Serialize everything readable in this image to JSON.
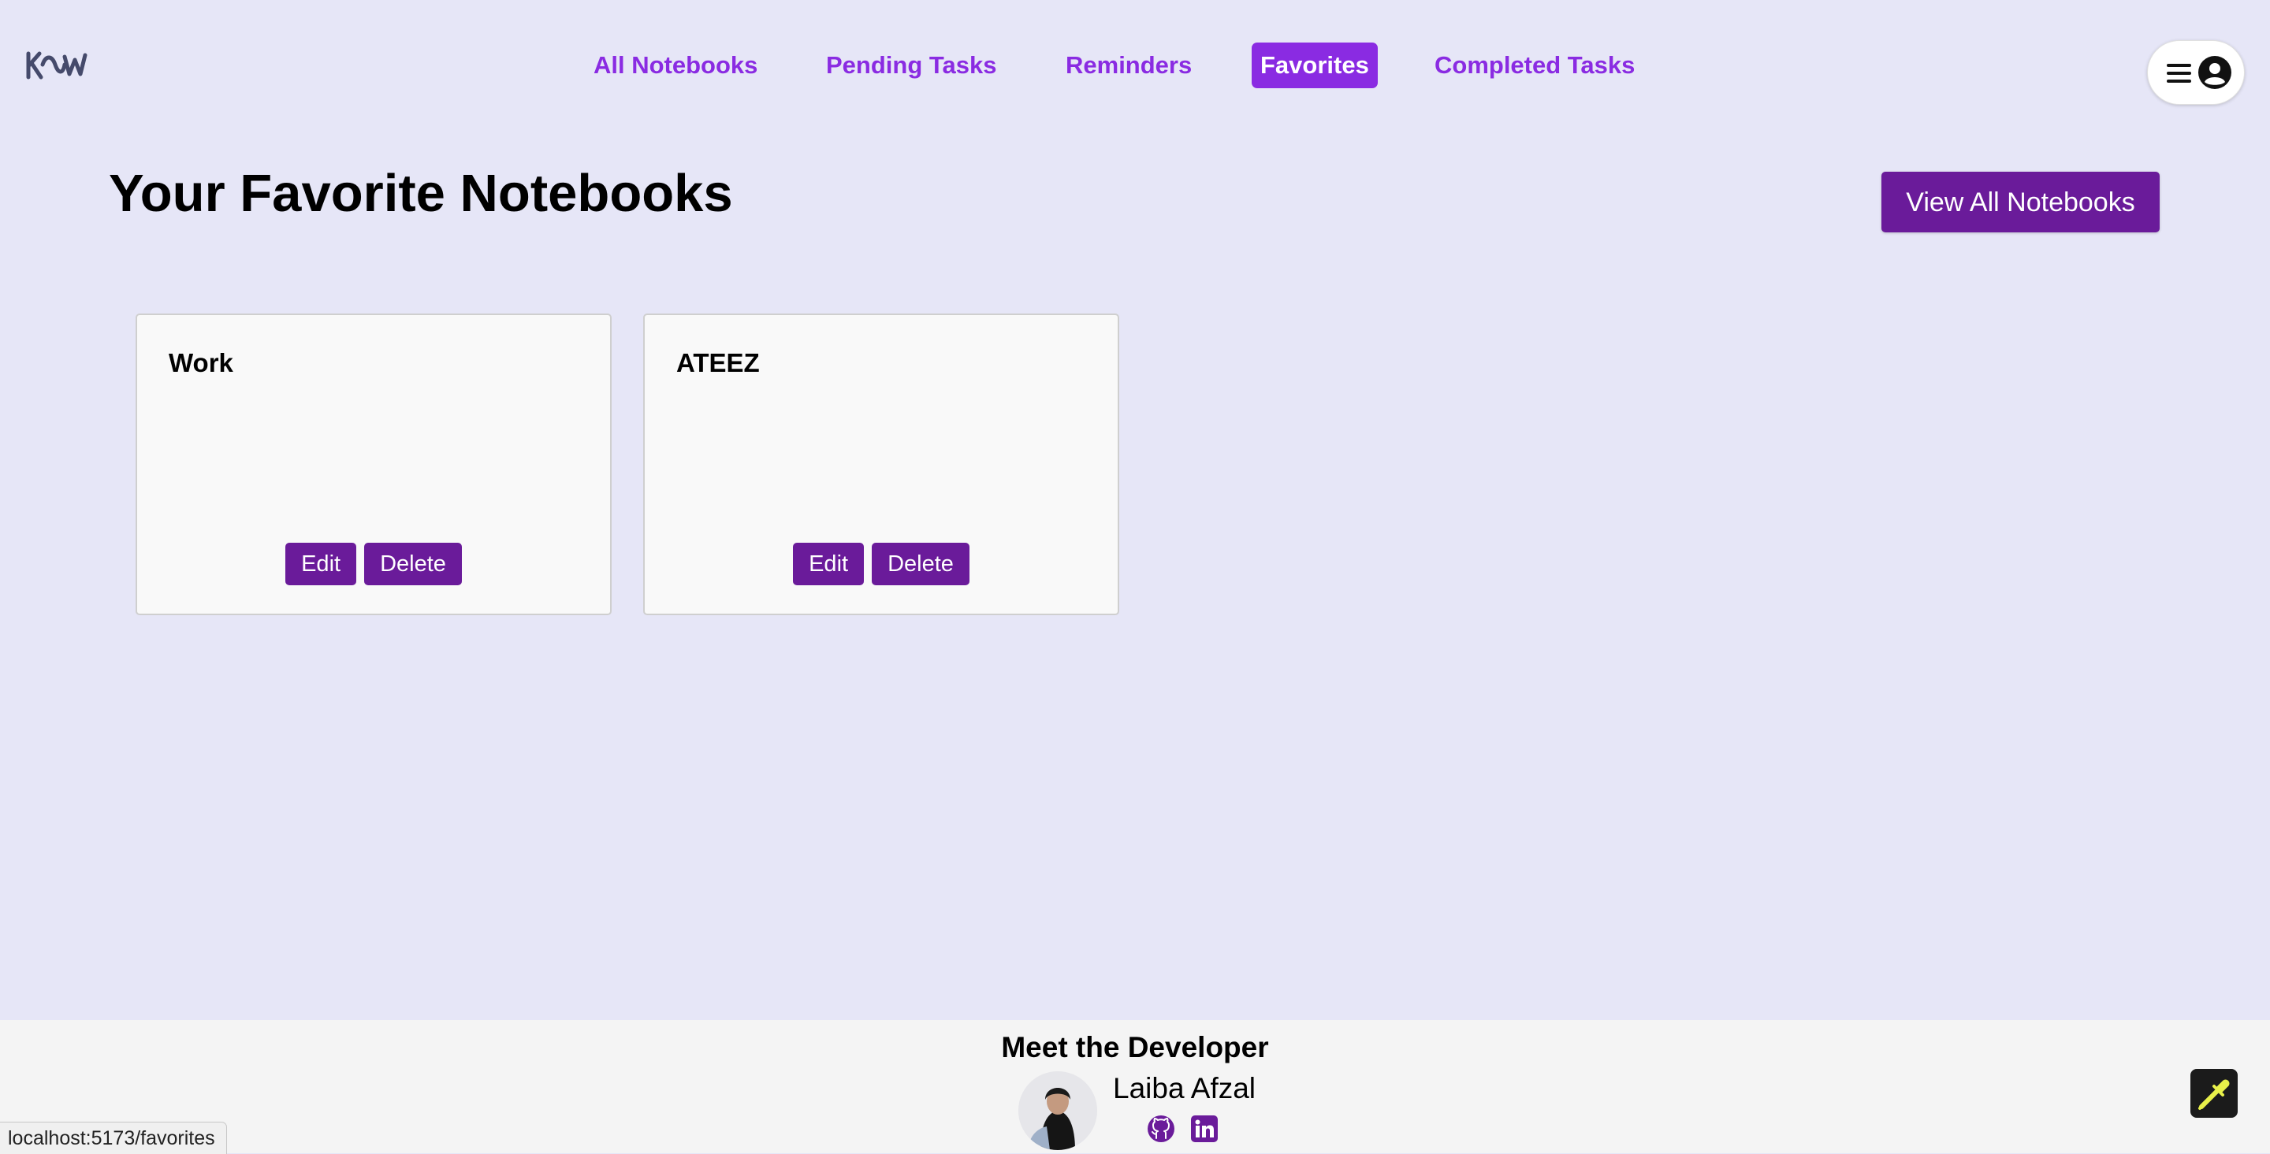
{
  "app": {
    "logo_text": "KMU"
  },
  "nav": {
    "items": [
      {
        "label": "All Notebooks",
        "active": false
      },
      {
        "label": "Pending Tasks",
        "active": false
      },
      {
        "label": "Reminders",
        "active": false
      },
      {
        "label": "Favorites",
        "active": true
      },
      {
        "label": "Completed Tasks",
        "active": false
      }
    ]
  },
  "user_menu": {
    "icons": [
      "hamburger-icon",
      "account-icon"
    ]
  },
  "main": {
    "title": "Your Favorite Notebooks",
    "view_all_label": "View All Notebooks",
    "cards": [
      {
        "title": "Work",
        "edit_label": "Edit",
        "delete_label": "Delete"
      },
      {
        "title": "ATEEZ",
        "edit_label": "Edit",
        "delete_label": "Delete"
      }
    ]
  },
  "footer": {
    "heading": "Meet the Developer",
    "developer_name": "Laiba Afzal",
    "links": [
      "github-icon",
      "linkedin-icon"
    ]
  },
  "status_bar": {
    "url": "localhost:5173/favorites"
  },
  "colors": {
    "background": "#e6e6f7",
    "accent": "#8a2be2",
    "button": "#6a1b9a",
    "footer": "#f4f4f4",
    "card": "#f9f9f9"
  }
}
